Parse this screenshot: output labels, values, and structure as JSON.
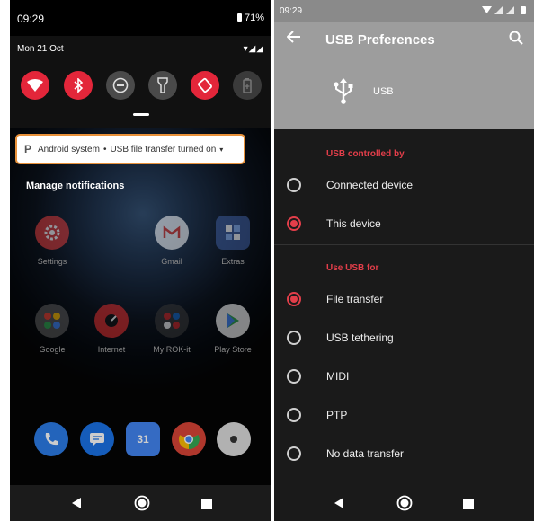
{
  "left": {
    "status": {
      "time": "09:29",
      "battery": "71%"
    },
    "quick_settings": {
      "date": "Mon 21 Oct",
      "signal_icons": "▾◢◢",
      "tiles": [
        {
          "icon": "wifi-icon",
          "state": "on"
        },
        {
          "icon": "bluetooth-icon",
          "state": "on"
        },
        {
          "icon": "do-not-disturb-icon",
          "state": "off"
        },
        {
          "icon": "flashlight-icon",
          "state": "off"
        },
        {
          "icon": "auto-rotate-icon",
          "state": "on"
        },
        {
          "icon": "battery-saver-icon",
          "state": "disabled"
        }
      ]
    },
    "notification": {
      "app": "Android system",
      "separator": "•",
      "text": "USB file transfer turned on"
    },
    "manage_notifications": "Manage notifications",
    "apps": [
      {
        "label": "Settings",
        "icon": "settings-icon"
      },
      {
        "label": "Gmail",
        "icon": "gmail-icon"
      },
      {
        "label": "Extras",
        "icon": "extras-icon"
      },
      {
        "label": "Google",
        "icon": "google-folder-icon"
      },
      {
        "label": "Internet",
        "icon": "internet-icon"
      },
      {
        "label": "My ROK-it",
        "icon": "rokit-icon"
      },
      {
        "label": "Play Store",
        "icon": "play-store-icon"
      }
    ],
    "dock": [
      {
        "icon": "phone-icon"
      },
      {
        "icon": "messages-icon"
      },
      {
        "icon": "calendar-icon",
        "text": "31"
      },
      {
        "icon": "chrome-icon"
      },
      {
        "icon": "camera-icon"
      }
    ]
  },
  "right": {
    "status": {
      "time": "09:29"
    },
    "title": "USB Preferences",
    "usb_label": "USB",
    "section1": "USB controlled by",
    "controlled_options": [
      {
        "label": "Connected device",
        "selected": false
      },
      {
        "label": "This device",
        "selected": true
      }
    ],
    "section2": "Use USB for",
    "use_options": [
      {
        "label": "File transfer",
        "selected": true
      },
      {
        "label": "USB tethering",
        "selected": false
      },
      {
        "label": "MIDI",
        "selected": false
      },
      {
        "label": "PTP",
        "selected": false
      },
      {
        "label": "No data transfer",
        "selected": false
      }
    ]
  },
  "colors": {
    "accent_red": "#e33e4a",
    "tile_on": "#e3263a",
    "notification_highlight": "#e8913a",
    "appbar_gray": "#9d9d9d"
  }
}
